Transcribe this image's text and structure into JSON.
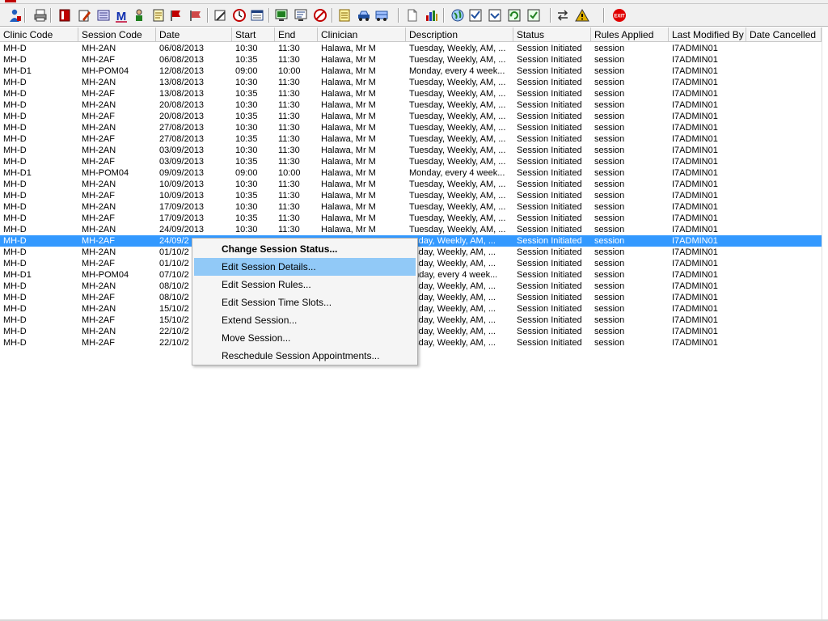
{
  "toolbar": {
    "buttons": [
      {
        "name": "user-admin-icon",
        "color": "#1f5fbf"
      },
      {
        "name": "print-icon",
        "color": "#404040"
      },
      {
        "name": "book-icon",
        "color": "#c00000"
      },
      {
        "name": "edit-form-icon",
        "color": "#805000"
      },
      {
        "name": "list-icon",
        "color": "#303080"
      },
      {
        "name": "m-icon",
        "color": "#c00030"
      },
      {
        "name": "person-icon",
        "color": "#208020"
      },
      {
        "name": "notes-icon",
        "color": "#806000"
      },
      {
        "name": "flag-icon",
        "color": "#c00000"
      },
      {
        "name": "flag-alt-icon",
        "color": "#c00000"
      },
      {
        "name": "pencil-icon",
        "color": "#303030"
      },
      {
        "name": "clock-icon",
        "color": "#c00000"
      },
      {
        "name": "window-icon",
        "color": "#204080"
      },
      {
        "name": "screen-icon",
        "color": "#208020"
      },
      {
        "name": "screen-edit-icon",
        "color": "#204080"
      },
      {
        "name": "no-entry-icon",
        "color": "#c00000"
      },
      {
        "name": "note-icon",
        "color": "#c09000"
      },
      {
        "name": "car-icon",
        "color": "#2050a0"
      },
      {
        "name": "transport-icon",
        "color": "#2050a0"
      },
      {
        "name": "document-icon",
        "color": "#606060"
      },
      {
        "name": "bar-chart-icon",
        "color": "#2040c0"
      },
      {
        "name": "globe-icon",
        "color": "#208020"
      },
      {
        "name": "checklist-icon",
        "color": "#2050a0"
      },
      {
        "name": "check-down-icon",
        "color": "#2050a0"
      },
      {
        "name": "refresh-icon",
        "color": "#208020"
      },
      {
        "name": "refresh-check-icon",
        "color": "#208020"
      },
      {
        "name": "swap-arrows-icon",
        "color": "#303030"
      },
      {
        "name": "warning-icon",
        "color": "#e0b000"
      },
      {
        "name": "exit-icon",
        "color": "#e00000"
      }
    ]
  },
  "columns": [
    "Clinic Code",
    "Session Code",
    "Date",
    "Start",
    "End",
    "Clinician",
    "Description",
    "Status",
    "Rules Applied",
    "Last Modified By",
    "Date Cancelled"
  ],
  "rows": [
    [
      "MH-D",
      "MH-2AN",
      "06/08/2013",
      "10:30",
      "11:30",
      "Halawa, Mr M",
      "Tuesday, Weekly, AM, ...",
      "Session Initiated",
      "session",
      "I7ADMIN01",
      ""
    ],
    [
      "MH-D",
      "MH-2AF",
      "06/08/2013",
      "10:35",
      "11:30",
      "Halawa, Mr M",
      "Tuesday, Weekly, AM, ...",
      "Session Initiated",
      "session",
      "I7ADMIN01",
      ""
    ],
    [
      "MH-D1",
      "MH-POM04",
      "12/08/2013",
      "09:00",
      "10:00",
      "Halawa, Mr M",
      "Monday, every 4 week...",
      "Session Initiated",
      "session",
      "I7ADMIN01",
      ""
    ],
    [
      "MH-D",
      "MH-2AN",
      "13/08/2013",
      "10:30",
      "11:30",
      "Halawa, Mr M",
      "Tuesday, Weekly, AM, ...",
      "Session Initiated",
      "session",
      "I7ADMIN01",
      ""
    ],
    [
      "MH-D",
      "MH-2AF",
      "13/08/2013",
      "10:35",
      "11:30",
      "Halawa, Mr M",
      "Tuesday, Weekly, AM, ...",
      "Session Initiated",
      "session",
      "I7ADMIN01",
      ""
    ],
    [
      "MH-D",
      "MH-2AN",
      "20/08/2013",
      "10:30",
      "11:30",
      "Halawa, Mr M",
      "Tuesday, Weekly, AM, ...",
      "Session Initiated",
      "session",
      "I7ADMIN01",
      ""
    ],
    [
      "MH-D",
      "MH-2AF",
      "20/08/2013",
      "10:35",
      "11:30",
      "Halawa, Mr M",
      "Tuesday, Weekly, AM, ...",
      "Session Initiated",
      "session",
      "I7ADMIN01",
      ""
    ],
    [
      "MH-D",
      "MH-2AN",
      "27/08/2013",
      "10:30",
      "11:30",
      "Halawa, Mr M",
      "Tuesday, Weekly, AM, ...",
      "Session Initiated",
      "session",
      "I7ADMIN01",
      ""
    ],
    [
      "MH-D",
      "MH-2AF",
      "27/08/2013",
      "10:35",
      "11:30",
      "Halawa, Mr M",
      "Tuesday, Weekly, AM, ...",
      "Session Initiated",
      "session",
      "I7ADMIN01",
      ""
    ],
    [
      "MH-D",
      "MH-2AN",
      "03/09/2013",
      "10:30",
      "11:30",
      "Halawa, Mr M",
      "Tuesday, Weekly, AM, ...",
      "Session Initiated",
      "session",
      "I7ADMIN01",
      ""
    ],
    [
      "MH-D",
      "MH-2AF",
      "03/09/2013",
      "10:35",
      "11:30",
      "Halawa, Mr M",
      "Tuesday, Weekly, AM, ...",
      "Session Initiated",
      "session",
      "I7ADMIN01",
      ""
    ],
    [
      "MH-D1",
      "MH-POM04",
      "09/09/2013",
      "09:00",
      "10:00",
      "Halawa, Mr M",
      "Monday, every 4 week...",
      "Session Initiated",
      "session",
      "I7ADMIN01",
      ""
    ],
    [
      "MH-D",
      "MH-2AN",
      "10/09/2013",
      "10:30",
      "11:30",
      "Halawa, Mr M",
      "Tuesday, Weekly, AM, ...",
      "Session Initiated",
      "session",
      "I7ADMIN01",
      ""
    ],
    [
      "MH-D",
      "MH-2AF",
      "10/09/2013",
      "10:35",
      "11:30",
      "Halawa, Mr M",
      "Tuesday, Weekly, AM, ...",
      "Session Initiated",
      "session",
      "I7ADMIN01",
      ""
    ],
    [
      "MH-D",
      "MH-2AN",
      "17/09/2013",
      "10:30",
      "11:30",
      "Halawa, Mr M",
      "Tuesday, Weekly, AM, ...",
      "Session Initiated",
      "session",
      "I7ADMIN01",
      ""
    ],
    [
      "MH-D",
      "MH-2AF",
      "17/09/2013",
      "10:35",
      "11:30",
      "Halawa, Mr M",
      "Tuesday, Weekly, AM, ...",
      "Session Initiated",
      "session",
      "I7ADMIN01",
      ""
    ],
    [
      "MH-D",
      "MH-2AN",
      "24/09/2013",
      "10:30",
      "11:30",
      "Halawa, Mr M",
      "Tuesday, Weekly, AM, ...",
      "Session Initiated",
      "session",
      "I7ADMIN01",
      ""
    ],
    [
      "MH-D",
      "MH-2AF",
      "24/09/2",
      "",
      "",
      "",
      "esday, Weekly, AM, ...",
      "Session Initiated",
      "session",
      "I7ADMIN01",
      ""
    ],
    [
      "MH-D",
      "MH-2AN",
      "01/10/2",
      "",
      "",
      "",
      "esday, Weekly, AM, ...",
      "Session Initiated",
      "session",
      "I7ADMIN01",
      ""
    ],
    [
      "MH-D",
      "MH-2AF",
      "01/10/2",
      "",
      "",
      "",
      "esday, Weekly, AM, ...",
      "Session Initiated",
      "session",
      "I7ADMIN01",
      ""
    ],
    [
      "MH-D1",
      "MH-POM04",
      "07/10/2",
      "",
      "",
      "",
      "onday, every 4 week...",
      "Session Initiated",
      "session",
      "I7ADMIN01",
      ""
    ],
    [
      "MH-D",
      "MH-2AN",
      "08/10/2",
      "",
      "",
      "",
      "esday, Weekly, AM, ...",
      "Session Initiated",
      "session",
      "I7ADMIN01",
      ""
    ],
    [
      "MH-D",
      "MH-2AF",
      "08/10/2",
      "",
      "",
      "",
      "esday, Weekly, AM, ...",
      "Session Initiated",
      "session",
      "I7ADMIN01",
      ""
    ],
    [
      "MH-D",
      "MH-2AN",
      "15/10/2",
      "",
      "",
      "",
      "esday, Weekly, AM, ...",
      "Session Initiated",
      "session",
      "I7ADMIN01",
      ""
    ],
    [
      "MH-D",
      "MH-2AF",
      "15/10/2",
      "",
      "",
      "",
      "esday, Weekly, AM, ...",
      "Session Initiated",
      "session",
      "I7ADMIN01",
      ""
    ],
    [
      "MH-D",
      "MH-2AN",
      "22/10/2",
      "",
      "",
      "",
      "esday, Weekly, AM, ...",
      "Session Initiated",
      "session",
      "I7ADMIN01",
      ""
    ],
    [
      "MH-D",
      "MH-2AF",
      "22/10/2",
      "",
      "",
      "",
      "esday, Weekly, AM, ...",
      "Session Initiated",
      "session",
      "I7ADMIN01",
      ""
    ]
  ],
  "selected_row": 17,
  "context_menu": {
    "items": [
      {
        "label": "Change Session Status...",
        "name": "menu-change-session-status",
        "bold": true,
        "highlighted": false
      },
      {
        "label": "Edit Session Details...",
        "name": "menu-edit-session-details",
        "bold": false,
        "highlighted": true
      },
      {
        "label": "Edit Session Rules...",
        "name": "menu-edit-session-rules",
        "bold": false,
        "highlighted": false
      },
      {
        "label": "Edit Session Time Slots...",
        "name": "menu-edit-session-time-slots",
        "bold": false,
        "highlighted": false
      },
      {
        "label": "Extend Session...",
        "name": "menu-extend-session",
        "bold": false,
        "highlighted": false
      },
      {
        "label": "Move Session...",
        "name": "menu-move-session",
        "bold": false,
        "highlighted": false
      },
      {
        "label": "Reschedule Session Appointments...",
        "name": "menu-reschedule-session-appointments",
        "bold": false,
        "highlighted": false
      }
    ]
  },
  "colors": {
    "selection": "#3399ff",
    "menu_highlight": "#91c9f7",
    "menu_background": "#f5f5f5"
  }
}
